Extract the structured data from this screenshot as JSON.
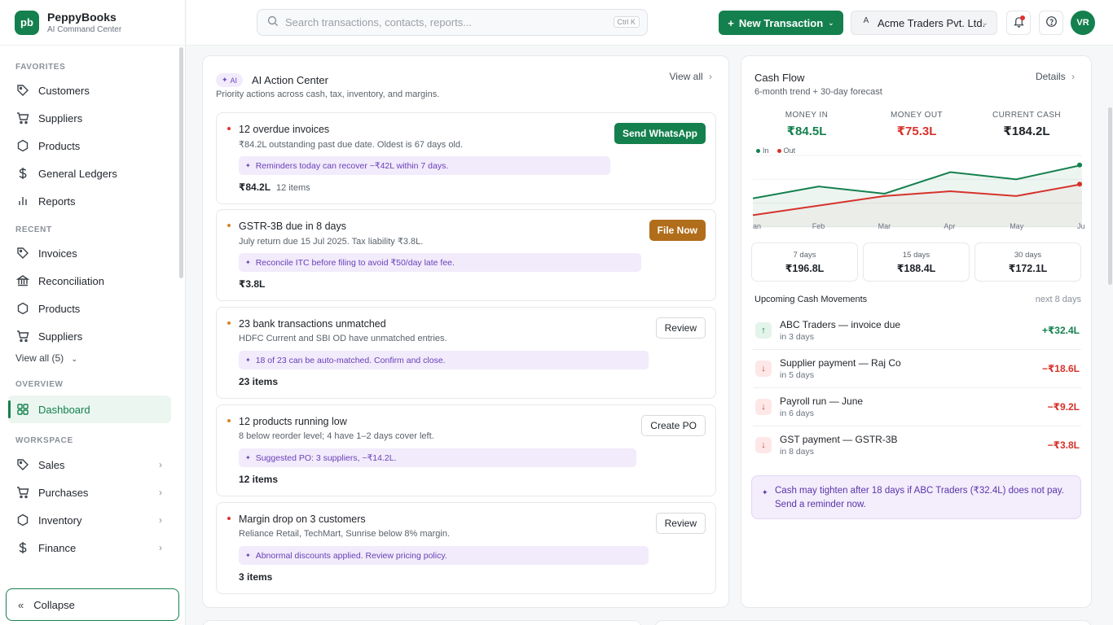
{
  "brand": {
    "logo": "pb",
    "name": "PeppyBooks",
    "subtitle": "AI Command Center"
  },
  "sidebar": {
    "favorites_title": "FAVORITES",
    "favorites": [
      {
        "label": "Customers",
        "icon": "tag-icon"
      },
      {
        "label": "Suppliers",
        "icon": "cart-icon"
      },
      {
        "label": "Products",
        "icon": "hexagon-icon"
      },
      {
        "label": "General Ledgers",
        "icon": "dollar-icon"
      },
      {
        "label": "Reports",
        "icon": "bar-chart-icon"
      }
    ],
    "recent_title": "RECENT",
    "recent": [
      {
        "label": "Invoices",
        "icon": "tag-icon"
      },
      {
        "label": "Reconciliation",
        "icon": "bank-icon"
      },
      {
        "label": "Products",
        "icon": "hexagon-icon"
      },
      {
        "label": "Suppliers",
        "icon": "cart-icon"
      }
    ],
    "view_all": "View all (5)",
    "overview_title": "OVERVIEW",
    "dashboard": "Dashboard",
    "workspace_title": "WORKSPACE",
    "workspace": [
      {
        "label": "Sales",
        "icon": "tag-icon"
      },
      {
        "label": "Purchases",
        "icon": "cart-icon"
      },
      {
        "label": "Inventory",
        "icon": "hexagon-icon"
      },
      {
        "label": "Finance",
        "icon": "dollar-icon"
      }
    ],
    "collapse": "Collapse"
  },
  "header": {
    "search_placeholder": "Search transactions, contacts, reports...",
    "search_shortcut": "Ctrl K",
    "new_transaction": "New Transaction",
    "company_initial": "A",
    "company_name": "Acme Traders Pvt. Ltd.",
    "avatar": "VR"
  },
  "action_center": {
    "badge": "AI",
    "title": "AI Action Center",
    "subtitle": "Priority actions across cash, tax, inventory, and margins.",
    "view_all": "View all",
    "items": [
      {
        "title": "12 overdue invoices",
        "desc": "₹84.2L outstanding past due date. Oldest is 67 days old.",
        "tip": "Reminders today can recover ~₹42L within 7 days.",
        "amount": "₹84.2L",
        "count": "12 items",
        "action": "Send WhatsApp",
        "dot": "#e03131"
      },
      {
        "title": "GSTR-3B due in 8 days",
        "desc": "July return due 15 Jul 2025. Tax liability ₹3.8L.",
        "tip": "Reconcile ITC before filing to avoid ₹50/day late fee.",
        "amount": "₹3.8L",
        "count": "",
        "action": "File Now",
        "dot": "#d9822b"
      },
      {
        "title": "23 bank transactions unmatched",
        "desc": "HDFC Current and SBI OD have unmatched entries.",
        "tip": "18 of 23 can be auto-matched. Confirm and close.",
        "amount": "23 items",
        "count": "",
        "action": "Review",
        "dot": "#d9822b"
      },
      {
        "title": "12 products running low",
        "desc": "8 below reorder level; 4 have 1–2 days cover left.",
        "tip": "Suggested PO: 3 suppliers, ~₹14.2L.",
        "amount": "12 items",
        "count": "",
        "action": "Create PO",
        "dot": "#d9822b"
      },
      {
        "title": "Margin drop on 3 customers",
        "desc": "Reliance Retail, TechMart, Sunrise below 8% margin.",
        "tip": "Abnormal discounts applied. Review pricing policy.",
        "amount": "3 items",
        "count": "",
        "action": "Review",
        "dot": "#e03131"
      }
    ]
  },
  "cash_flow": {
    "title": "Cash Flow",
    "subtitle": "6-month trend + 30-day forecast",
    "details": "Details",
    "metrics": [
      {
        "label": "MONEY IN",
        "value": "₹84.5L",
        "color": "#14804e"
      },
      {
        "label": "MONEY OUT",
        "value": "₹75.3L",
        "color": "#d6332b"
      },
      {
        "label": "CURRENT CASH",
        "value": "₹184.2L",
        "color": "#1f2328"
      }
    ],
    "legend_in": "In",
    "legend_out": "Out",
    "forecast": [
      {
        "label": "7 days",
        "value": "₹196.8L"
      },
      {
        "label": "15 days",
        "value": "₹188.4L"
      },
      {
        "label": "30 days",
        "value": "₹172.1L"
      }
    ],
    "upcoming_title": "Upcoming Cash Movements",
    "upcoming_window": "next 8 days",
    "movements": [
      {
        "title": "ABC Traders — invoice due",
        "when": "in 3 days",
        "amount": "+₹32.4L",
        "dir": "in"
      },
      {
        "title": "Supplier payment — Raj Co",
        "when": "in 5 days",
        "amount": "−₹18.6L",
        "dir": "out"
      },
      {
        "title": "Payroll run — June",
        "when": "in 6 days",
        "amount": "−₹9.2L",
        "dir": "out"
      },
      {
        "title": "GST payment — GSTR-3B",
        "when": "in 8 days",
        "amount": "−₹3.8L",
        "dir": "out"
      }
    ],
    "alert": "Cash may tighten after 18 days if ABC Traders (₹32.4L) does not pay. Send a reminder now."
  },
  "chart_data": {
    "type": "line",
    "x": [
      "Jan",
      "Feb",
      "Mar",
      "Apr",
      "May",
      "Jun"
    ],
    "series": [
      {
        "name": "In",
        "color": "#14804e",
        "values": [
          82,
          87,
          84,
          93,
          90,
          96
        ]
      },
      {
        "name": "Out",
        "color": "#d6332b",
        "values": [
          75,
          79,
          83,
          85,
          83,
          88
        ]
      }
    ]
  }
}
